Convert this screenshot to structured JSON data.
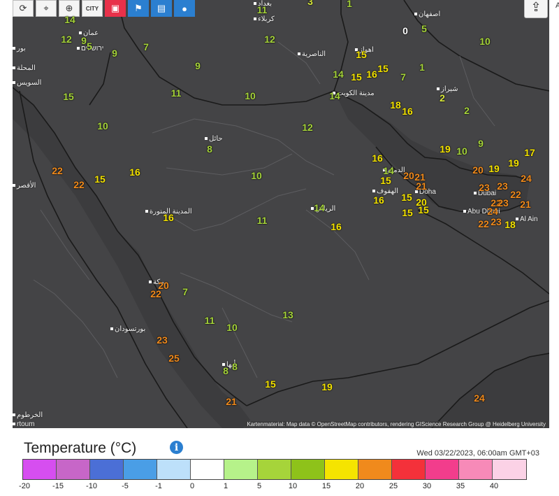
{
  "toolbar": {
    "buttons": [
      {
        "name": "refresh-icon",
        "glyph": "⟳",
        "style": "white"
      },
      {
        "name": "location-pin-icon",
        "glyph": "⌖",
        "style": "white"
      },
      {
        "name": "zoom-icon",
        "glyph": "⊕",
        "style": "white"
      },
      {
        "name": "city-icon",
        "glyph": "CITY",
        "style": "white"
      },
      {
        "name": "layers-icon",
        "glyph": "▣",
        "style": "red"
      },
      {
        "name": "station-icon",
        "glyph": "⚑",
        "style": "blue"
      },
      {
        "name": "device-icon",
        "glyph": "▤",
        "style": "blue"
      },
      {
        "name": "balloon-icon",
        "glyph": "●",
        "style": "blue"
      }
    ],
    "share_glyph": "⇪"
  },
  "edge_text": "A",
  "places": [
    {
      "text": "بغداد"
    },
    {
      "text": "كربلاء"
    },
    {
      "text": "عمان"
    },
    {
      "text": "ירושלים"
    },
    {
      "text": "اصفهان"
    },
    {
      "text": "الناصرية"
    },
    {
      "text": "اهواز"
    },
    {
      "text": "مدينة الكويت"
    },
    {
      "text": "شيراز"
    },
    {
      "text": "السويس"
    },
    {
      "text": "حائل"
    },
    {
      "text": "الأقصر"
    },
    {
      "text": "المدينة المنورة"
    },
    {
      "text": "الهفوف"
    },
    {
      "text": "الدمام"
    },
    {
      "text": "Doha"
    },
    {
      "text": "Dubai"
    },
    {
      "text": "Abu Dhabi"
    },
    {
      "text": "Al Ain"
    },
    {
      "text": "الرياض"
    },
    {
      "text": "مكة"
    },
    {
      "text": "بورتسودان"
    },
    {
      "text": "أبها"
    },
    {
      "text": "الخرطوم"
    },
    {
      "text": "rtoum"
    },
    {
      "text": "المحلة"
    },
    {
      "text": "بور"
    }
  ],
  "temperatures": [
    {
      "v": "14",
      "c": "#a6d43a"
    },
    {
      "v": "11",
      "c": "#a6d43a"
    },
    {
      "v": "3",
      "c": "#d8e83a"
    },
    {
      "v": "1",
      "c": "#a6d43a"
    },
    {
      "v": "12",
      "c": "#a6d43a"
    },
    {
      "v": "9",
      "c": "#a6d43a"
    },
    {
      "v": "5",
      "c": "#a6d43a"
    },
    {
      "v": "9",
      "c": "#a6d43a"
    },
    {
      "v": "7",
      "c": "#a6d43a"
    },
    {
      "v": "12",
      "c": "#a6d43a"
    },
    {
      "v": "5",
      "c": "#a6d43a"
    },
    {
      "v": "10",
      "c": "#a6d43a"
    },
    {
      "v": "9",
      "c": "#a6d43a"
    },
    {
      "v": "15",
      "c": "#a6d43a"
    },
    {
      "v": "14",
      "c": "#a6d43a"
    },
    {
      "v": "15",
      "c": "#f5e400"
    },
    {
      "v": "16",
      "c": "#f5e400"
    },
    {
      "v": "15",
      "c": "#f5e400"
    },
    {
      "v": "7",
      "c": "#a6d43a"
    },
    {
      "v": "1",
      "c": "#a6d43a"
    },
    {
      "v": "15",
      "c": "#f5e400"
    },
    {
      "v": "11",
      "c": "#a6d43a"
    },
    {
      "v": "10",
      "c": "#a6d43a"
    },
    {
      "v": "14",
      "c": "#a6d43a"
    },
    {
      "v": "18",
      "c": "#f5e400"
    },
    {
      "v": "16",
      "c": "#f5e400"
    },
    {
      "v": "2",
      "c": "#d8e83a"
    },
    {
      "v": "2",
      "c": "#a6d43a"
    },
    {
      "v": "10",
      "c": "#a6d43a"
    },
    {
      "v": "12",
      "c": "#a6d43a"
    },
    {
      "v": "8",
      "c": "#a6d43a"
    },
    {
      "v": "19",
      "c": "#f5e400"
    },
    {
      "v": "10",
      "c": "#a6d43a"
    },
    {
      "v": "9",
      "c": "#a6d43a"
    },
    {
      "v": "17",
      "c": "#f5e400"
    },
    {
      "v": "22",
      "c": "#f08a1c"
    },
    {
      "v": "15",
      "c": "#f5e400"
    },
    {
      "v": "16",
      "c": "#f5e400"
    },
    {
      "v": "22",
      "c": "#f08a1c"
    },
    {
      "v": "10",
      "c": "#a6d43a"
    },
    {
      "v": "16",
      "c": "#f5e400"
    },
    {
      "v": "14",
      "c": "#a6d43a"
    },
    {
      "v": "15",
      "c": "#f5e400"
    },
    {
      "v": "20",
      "c": "#f08a1c"
    },
    {
      "v": "21",
      "c": "#f08a1c"
    },
    {
      "v": "21",
      "c": "#f08a1c"
    },
    {
      "v": "20",
      "c": "#f08a1c"
    },
    {
      "v": "19",
      "c": "#f5e400"
    },
    {
      "v": "19",
      "c": "#f5e400"
    },
    {
      "v": "24",
      "c": "#f08a1c"
    },
    {
      "v": "23",
      "c": "#f08a1c"
    },
    {
      "v": "23",
      "c": "#f08a1c"
    },
    {
      "v": "22",
      "c": "#f08a1c"
    },
    {
      "v": "16",
      "c": "#f5e400"
    },
    {
      "v": "15",
      "c": "#f5e400"
    },
    {
      "v": "20",
      "c": "#f5e400"
    },
    {
      "v": "15",
      "c": "#f5e400"
    },
    {
      "v": "22",
      "c": "#f08a1c"
    },
    {
      "v": "23",
      "c": "#f08a1c"
    },
    {
      "v": "21",
      "c": "#f08a1c"
    },
    {
      "v": "24",
      "c": "#f08a1c"
    },
    {
      "v": "22",
      "c": "#f08a1c"
    },
    {
      "v": "23",
      "c": "#f08a1c"
    },
    {
      "v": "18",
      "c": "#f5e400"
    },
    {
      "v": "15",
      "c": "#f5e400"
    },
    {
      "v": "16",
      "c": "#f5e400"
    },
    {
      "v": "11",
      "c": "#a6d43a"
    },
    {
      "v": "14",
      "c": "#a6d43a"
    },
    {
      "v": "16",
      "c": "#f5e400"
    },
    {
      "v": "20",
      "c": "#f08a1c"
    },
    {
      "v": "22",
      "c": "#f08a1c"
    },
    {
      "v": "7",
      "c": "#a6d43a"
    },
    {
      "v": "13",
      "c": "#a6d43a"
    },
    {
      "v": "11",
      "c": "#a6d43a"
    },
    {
      "v": "10",
      "c": "#a6d43a"
    },
    {
      "v": "23",
      "c": "#f08a1c"
    },
    {
      "v": "25",
      "c": "#f08a1c"
    },
    {
      "v": "8",
      "c": "#a6d43a"
    },
    {
      "v": "8",
      "c": "#a6d43a"
    },
    {
      "v": "15",
      "c": "#f5e400"
    },
    {
      "v": "19",
      "c": "#f5e400"
    },
    {
      "v": "21",
      "c": "#f08a1c"
    },
    {
      "v": "24",
      "c": "#f08a1c"
    },
    {
      "v": "0",
      "c": "#ffffff"
    }
  ],
  "attribution": "Kartenmaterial: Map data © OpenStreetMap contributors, rendering GIScience Research Group @ Heidelberg University",
  "legend": {
    "title": "Temperature (°C)",
    "info_glyph": "i",
    "timestamp": "Wed 03/22/2023, 06:00am GMT+03",
    "colors": [
      "#d64ef0",
      "#c766c8",
      "#4b6fd6",
      "#4a9ee6",
      "#bde0fa",
      "#ffffff",
      "#b6f28a",
      "#a6d43a",
      "#8ec21a",
      "#f5e400",
      "#f08a1c",
      "#f4313a",
      "#f23d8c",
      "#f78ab8",
      "#fbd2e6"
    ],
    "ticks": [
      "-20",
      "-15",
      "-10",
      "-5",
      "-1",
      "0",
      "1",
      "5",
      "10",
      "15",
      "20",
      "25",
      "30",
      "35",
      "40"
    ]
  }
}
